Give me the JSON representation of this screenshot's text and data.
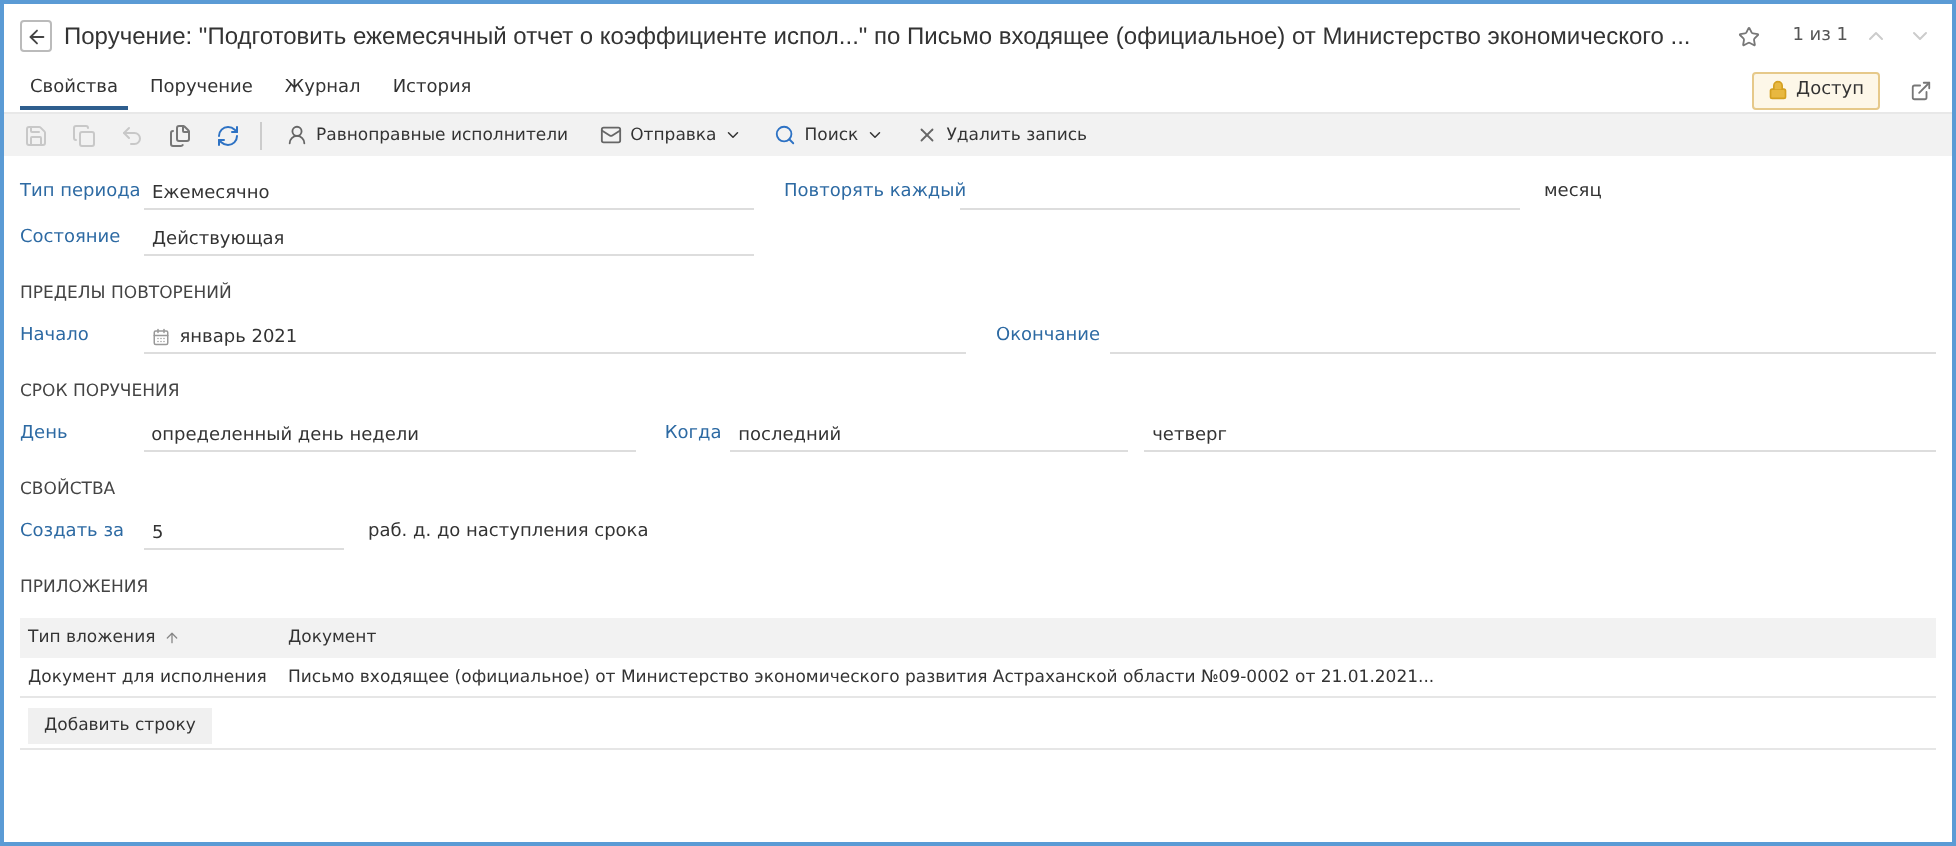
{
  "window": {
    "title": "Поручение: \"Подготовить ежемесячный отчет о коэффициенте испол...\" по Письмо входящее (официальное) от Министерство экономического ...",
    "pager": "1 из 1"
  },
  "tabs": [
    {
      "label": "Свойства",
      "selected": true
    },
    {
      "label": "Поручение",
      "selected": false
    },
    {
      "label": "Журнал",
      "selected": false
    },
    {
      "label": "История",
      "selected": false
    }
  ],
  "access_button": "Доступ",
  "toolbar": {
    "icon_buttons": [
      {
        "disabled": true
      },
      {
        "disabled": true
      },
      {
        "disabled": true
      },
      {
        "disabled": false
      },
      {
        "disabled": false
      }
    ],
    "buttons": [
      {
        "label": "Равноправные исполнители",
        "dropdown": false
      },
      {
        "label": "Отправка",
        "dropdown": true
      },
      {
        "label": "Поиск",
        "dropdown": true
      },
      {
        "label": "Удалить запись",
        "dropdown": false
      }
    ]
  },
  "period": {
    "type_label": "Тип периода",
    "type_value": "Ежемесячно",
    "repeat_label": "Повторять каждый",
    "repeat_unit": "месяц",
    "state_label": "Состояние",
    "state_value": "Действующая"
  },
  "limits": {
    "title": "ПРЕДЕЛЫ ПОВТОРЕНИЙ",
    "start_label": "Начало",
    "start_value": "январь 2021",
    "end_label": "Окончание"
  },
  "deadline": {
    "title": "СРОК ПОРУЧЕНИЯ",
    "day_label": "День",
    "day_value": "определенный день недели",
    "when_label": "Когда",
    "when_value": "последний",
    "weekday_value": "четверг"
  },
  "properties": {
    "title": "СВОЙСТВА",
    "create_label": "Создать за",
    "create_value": "5",
    "create_suffix": "раб. д. до наступления срока"
  },
  "attachments": {
    "title": "ПРИЛОЖЕНИЯ",
    "columns": [
      {
        "label": "Тип вложения",
        "sorted": true
      },
      {
        "label": "Документ",
        "sorted": false
      }
    ],
    "rows": [
      [
        "Документ для исполнения",
        "Письмо входящее (официальное) от Министерство экономического развития Астраханской области №09-0002 от 21.01.2021..."
      ]
    ],
    "add_button": "Добавить строку"
  }
}
